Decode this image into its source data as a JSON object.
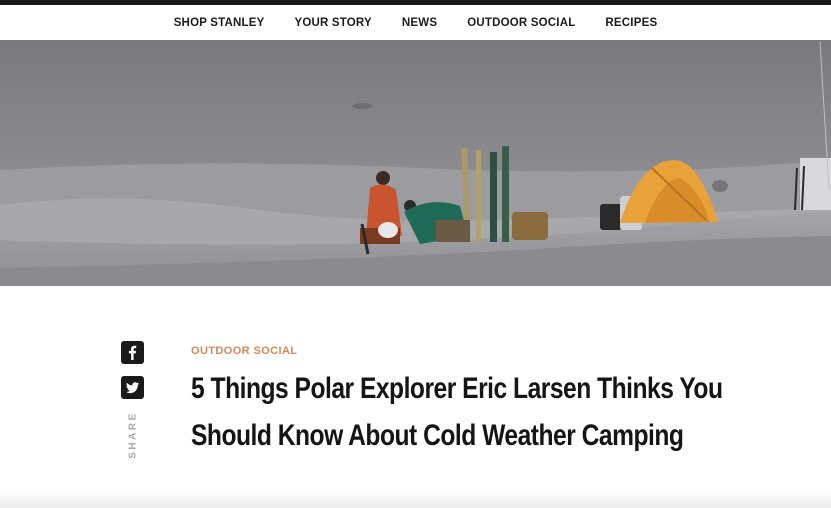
{
  "nav": {
    "items": [
      {
        "label": "SHOP STANLEY"
      },
      {
        "label": "YOUR STORY"
      },
      {
        "label": "NEWS"
      },
      {
        "label": "OUTDOOR SOCIAL"
      },
      {
        "label": "RECIPES"
      }
    ]
  },
  "share": {
    "label": "SHARE",
    "icons": [
      "facebook-icon",
      "twitter-icon"
    ]
  },
  "article": {
    "category": "OUTDOOR SOCIAL",
    "title": "5 Things Polar Explorer Eric Larsen Thinks You Should Know About Cold Weather Camping"
  },
  "colors": {
    "category": "#d1895a",
    "tent": "#e9a23a",
    "jacket_red": "#c9542f",
    "jacket_green": "#1f6b58"
  }
}
